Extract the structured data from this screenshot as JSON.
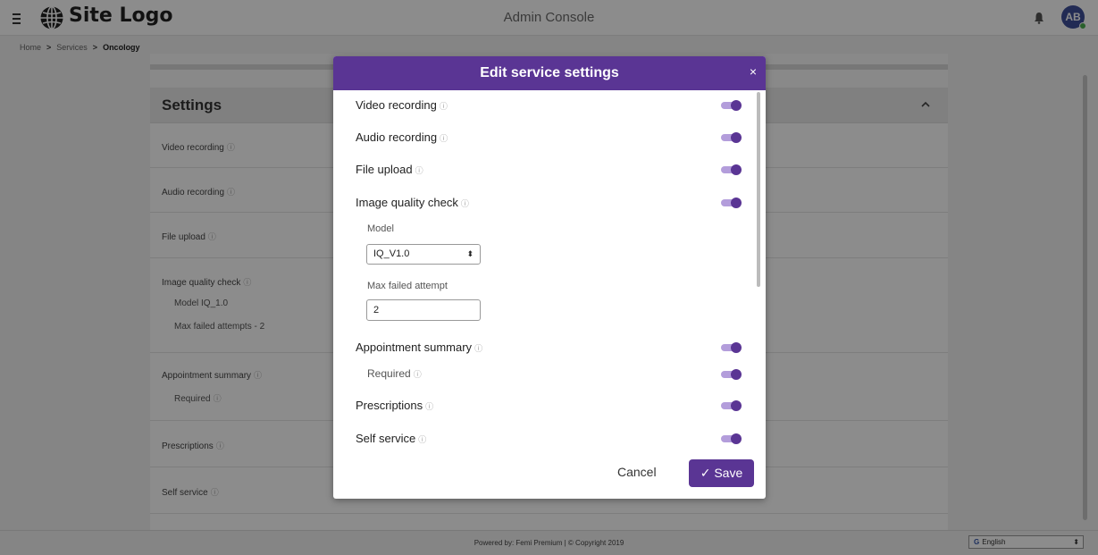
{
  "topbar": {
    "logo_text": "Site Logo",
    "app_title": "Admin Console",
    "avatar_initials": "AB"
  },
  "breadcrumb": {
    "items": [
      "Home",
      "Services",
      "Oncology"
    ]
  },
  "settings": {
    "title": "Settings",
    "rows": {
      "video": "Video recording",
      "audio": "Audio recording",
      "file": "File upload",
      "iqc": "Image quality check",
      "iqc_model": "Model IQ_1.0",
      "iqc_attempts": "Max failed attempts - 2",
      "appt": "Appointment summary",
      "appt_required": "Required",
      "rx": "Prescriptions",
      "self": "Self service"
    }
  },
  "modal": {
    "title": "Edit service settings",
    "close_glyph": "×",
    "video_label": "Video recording",
    "audio_label": "Audio recording",
    "file_label": "File upload",
    "iqc_label": "Image quality check",
    "model_label": "Model",
    "model_value": "IQ_V1.0",
    "attempt_label": "Max failed attempt",
    "attempt_value": "2",
    "appt_label": "Appointment summary",
    "required_label": "Required",
    "rx_label": "Prescriptions",
    "self_label": "Self service",
    "cancel_label": "Cancel",
    "save_label": "Save",
    "save_glyph": "✓",
    "toggles": {
      "video": true,
      "audio": true,
      "file": true,
      "iqc": true,
      "appt": true,
      "required": true,
      "rx": true,
      "self": true
    }
  },
  "footer": {
    "text": "Powered by: Femi Premium | © Copyright 2019",
    "language": "English"
  },
  "colors": {
    "accent": "#5a3594",
    "toggle_track": "#b39ddb",
    "avatar": "#3e4f9a",
    "online": "#4caf50"
  },
  "icons": {
    "info": "ⓘ",
    "select_arrows": "⬍"
  }
}
